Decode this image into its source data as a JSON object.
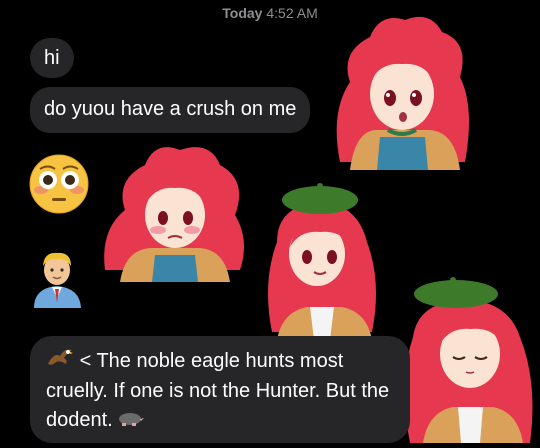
{
  "header": {
    "day": "Today",
    "time": "4:52 AM"
  },
  "messages": [
    {
      "text": "hi"
    },
    {
      "text": "do yuou have a crush on me"
    },
    {
      "emoji": "flushed-face"
    },
    {
      "emoji": "man-office-worker"
    },
    {
      "prefix": "< The noble eagle hunts most cruelly. If one is not the Hunter. But the dodent.",
      "icons": [
        "eagle",
        "mole"
      ]
    }
  ]
}
